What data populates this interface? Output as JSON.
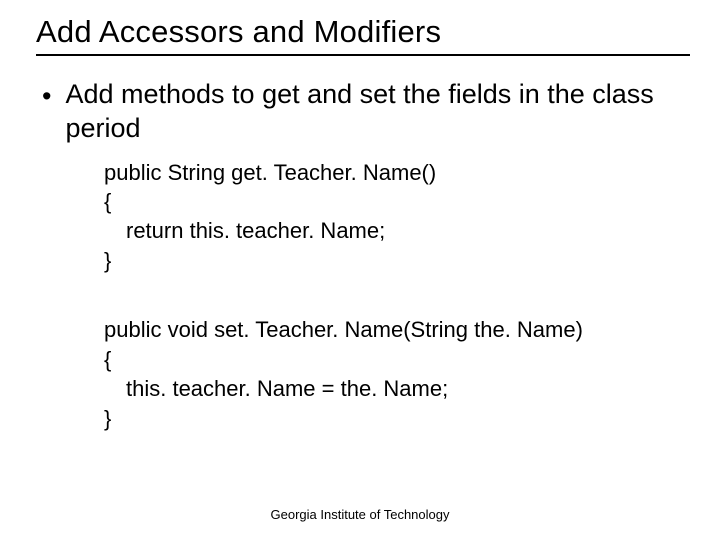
{
  "title": "Add Accessors and Modifiers",
  "bullet": "Add methods to get and set the fields in the class period",
  "code": {
    "block1": {
      "l1": "public String get. Teacher. Name()",
      "l2": "{",
      "l3": "return this. teacher. Name;",
      "l4": "}"
    },
    "block2": {
      "l1": "public void set. Teacher. Name(String the. Name)",
      "l2": "{",
      "l3": "this. teacher. Name = the. Name;",
      "l4": "}"
    }
  },
  "footer": "Georgia Institute of Technology"
}
